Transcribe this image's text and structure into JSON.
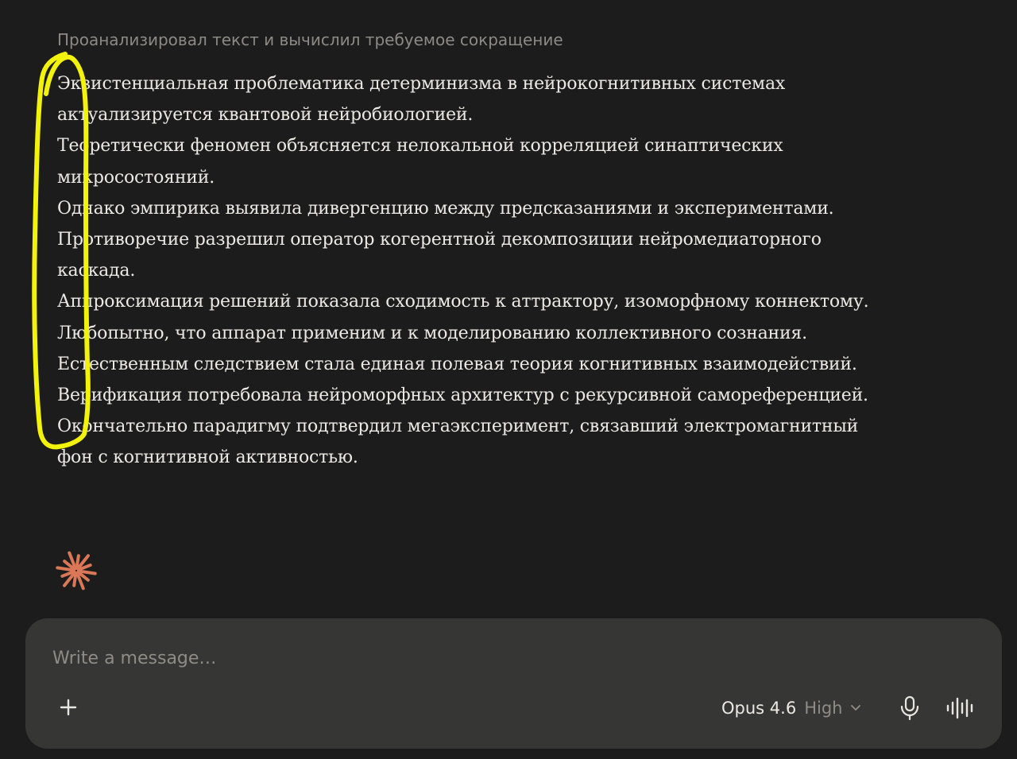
{
  "thinking": {
    "label": "Проанализировал текст и вычислил требуемое сокращение"
  },
  "message": {
    "lines": [
      "Экзистенциальная проблематика детерминизма в нейрокогнитивных системах",
      "актуализируется квантовой нейробиологией.",
      "Теоретически феномен объясняется нелокальной корреляцией синаптических",
      "микросостояний.",
      "Однако эмпирика выявила дивергенцию между предсказаниями и экспериментами.",
      "Противоречие разрешил оператор когерентной декомпозиции нейромедиаторного",
      "каскада.",
      "Аппроксимация решений показала сходимость к аттрактору, изоморфному коннектому.",
      "Любопытно, что аппарат применим и к моделированию коллективного сознания.",
      "Естественным следствием стала единая полевая теория когнитивных взаимодействий.",
      "Верификация потребовала нейроморфных архитектур с рекурсивной самореференцией.",
      "Окончательно парадигму подтвердил мегаэксперимент, связавший электромагнитный",
      "фон с когнитивной активностью."
    ]
  },
  "annotation": {
    "color": "#f2f20a"
  },
  "assistant": {
    "spark_color": "#d97757"
  },
  "composer": {
    "placeholder": "Write a message…",
    "model_name": "Opus 4.6",
    "effort": "High"
  },
  "icons": {
    "add": "plus-icon",
    "model_menu": "chevron-down-icon",
    "mic": "microphone-icon",
    "voice": "voice-waveform-icon"
  }
}
